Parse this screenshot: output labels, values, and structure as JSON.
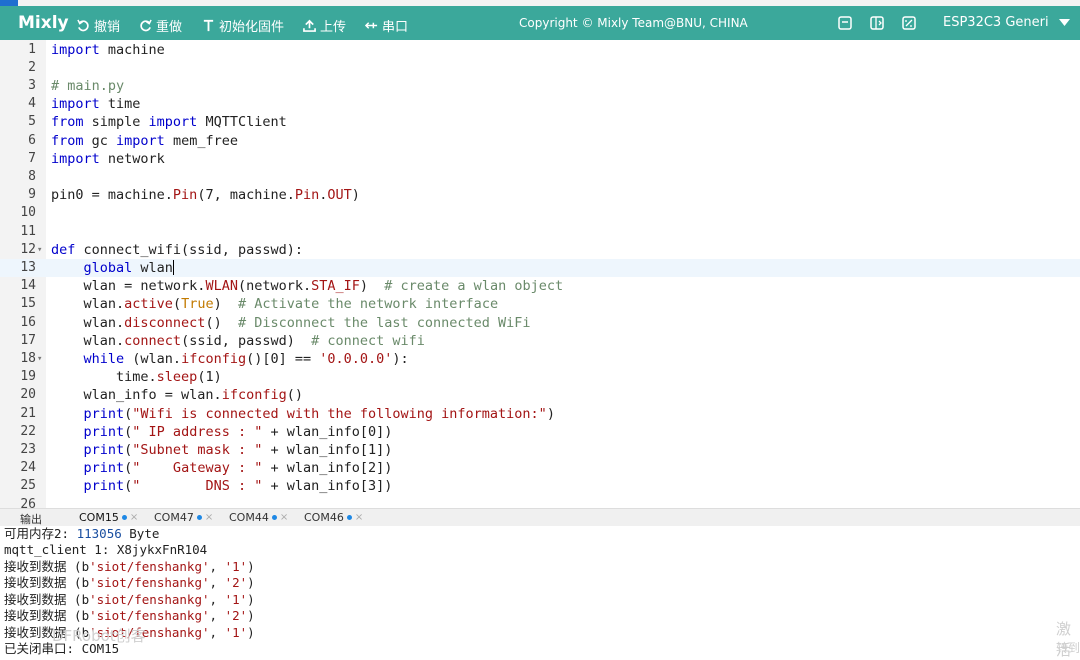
{
  "toolbar": {
    "brand": "Mixly",
    "undo": "撤销",
    "redo": "重做",
    "init_firmware": "初始化固件",
    "upload": "上传",
    "serial": "串口",
    "copyright": "Copyright © Mixly Team@BNU, CHINA",
    "board": "ESP32C3 Generi"
  },
  "editor": {
    "active_line": 13,
    "lines": [
      {
        "n": "1",
        "html": "<span class=\"kw\">import</span> machine"
      },
      {
        "n": "2",
        "html": ""
      },
      {
        "n": "3",
        "html": "<span class=\"cm\"># main.py</span>"
      },
      {
        "n": "4",
        "html": "<span class=\"kw\">import</span> time"
      },
      {
        "n": "5",
        "html": "<span class=\"kw\">from</span> simple <span class=\"kw\">import</span> MQTTClient"
      },
      {
        "n": "6",
        "html": "<span class=\"kw\">from</span> gc <span class=\"kw\">import</span> mem_free"
      },
      {
        "n": "7",
        "html": "<span class=\"kw\">import</span> network"
      },
      {
        "n": "8",
        "html": ""
      },
      {
        "n": "9",
        "html": "pin0 = machine.<span class=\"fn\">Pin</span>(7, machine.<span class=\"fn\">Pin</span>.<span class=\"fn\">OUT</span>)"
      },
      {
        "n": "10",
        "html": ""
      },
      {
        "n": "11",
        "html": ""
      },
      {
        "n": "12",
        "fold": true,
        "html": "<span class=\"kw\">def</span> connect_wifi(ssid, passwd):"
      },
      {
        "n": "13",
        "html": "    <span class=\"kw\">global</span> wlan<span class=\"cursor\"></span>"
      },
      {
        "n": "14",
        "html": "    wlan = network.<span class=\"fn\">WLAN</span>(network.<span class=\"fn\">STA_IF</span>)  <span class=\"cm\"># create a wlan object</span>"
      },
      {
        "n": "15",
        "html": "    wlan.<span class=\"fn\">active</span>(<span class=\"bool\">True</span>)  <span class=\"cm\"># Activate the network interface</span>"
      },
      {
        "n": "16",
        "html": "    wlan.<span class=\"fn\">disconnect</span>()  <span class=\"cm\"># Disconnect the last connected WiFi</span>"
      },
      {
        "n": "17",
        "html": "    wlan.<span class=\"fn\">connect</span>(ssid, passwd)  <span class=\"cm\"># connect wifi</span>"
      },
      {
        "n": "18",
        "fold": true,
        "html": "    <span class=\"kw\">while</span> (wlan.<span class=\"fn\">ifconfig</span>()[0] == <span class=\"str\">'0.0.0.0'</span>):"
      },
      {
        "n": "19",
        "html": "        time.<span class=\"fn\">sleep</span>(1)"
      },
      {
        "n": "20",
        "html": "    wlan_info = wlan.<span class=\"fn\">ifconfig</span>()"
      },
      {
        "n": "21",
        "html": "    <span class=\"kw\">print</span>(<span class=\"str\">\"Wifi is connected with the following information:\"</span>)"
      },
      {
        "n": "22",
        "html": "    <span class=\"kw\">print</span>(<span class=\"str\">\" IP address : \"</span> + wlan_info[0])"
      },
      {
        "n": "23",
        "html": "    <span class=\"kw\">print</span>(<span class=\"str\">\"Subnet mask : \"</span> + wlan_info[1])"
      },
      {
        "n": "24",
        "html": "    <span class=\"kw\">print</span>(<span class=\"str\">\"    Gateway : \"</span> + wlan_info[2])"
      },
      {
        "n": "25",
        "html": "    <span class=\"kw\">print</span>(<span class=\"str\">\"        DNS : \"</span> + wlan_info[3])"
      },
      {
        "n": "26",
        "html": ""
      }
    ]
  },
  "output": {
    "tabs": [
      {
        "label": "输出",
        "dot": false,
        "close": false
      },
      {
        "label": "COM15",
        "dot": true,
        "close": true,
        "active": true
      },
      {
        "label": "COM47",
        "dot": true,
        "close": true
      },
      {
        "label": "COM44",
        "dot": true,
        "close": true
      },
      {
        "label": "COM46",
        "dot": true,
        "close": true
      }
    ],
    "lines": [
      {
        "html": "<span class=\"zh\">可用内存</span>2: <span class=\"onum\">113056</span> Byte"
      },
      {
        "html": "mqtt_client 1: X8jykxFnR104"
      },
      {
        "html": "<span class=\"zh\">接收到数据</span> (b<span class=\"ostr\">'siot/fenshankg'</span>, <span class=\"ostr\">'1'</span>)"
      },
      {
        "html": "<span class=\"zh\">接收到数据</span> (b<span class=\"ostr\">'siot/fenshankg'</span>, <span class=\"ostr\">'2'</span>)"
      },
      {
        "html": "<span class=\"zh\">接收到数据</span> (b<span class=\"ostr\">'siot/fenshankg'</span>, <span class=\"ostr\">'1'</span>)"
      },
      {
        "html": "<span class=\"zh\">接收到数据</span> (b<span class=\"ostr\">'siot/fenshankg'</span>, <span class=\"ostr\">'2'</span>)"
      },
      {
        "html": "<span class=\"zh\">接收到数据</span> (b<span class=\"ostr\">'siot/fenshankg'</span>, <span class=\"ostr\">'1'</span>)"
      },
      {
        "html": "<span class=\"zh\">已关闭串口</span>: COM15"
      }
    ],
    "watermark_left": "DFRobot创客",
    "watermark_right_1": "激活",
    "watermark_right_2": "转到"
  }
}
